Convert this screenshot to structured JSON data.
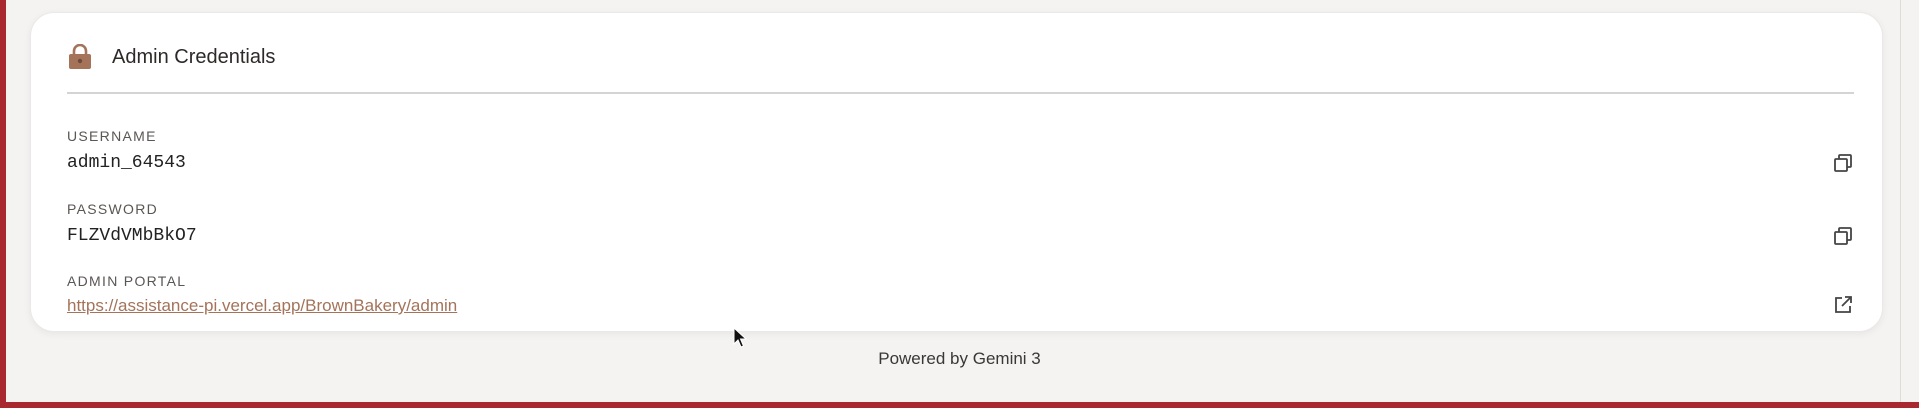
{
  "card": {
    "title": "Admin Credentials",
    "icon": "lock-icon",
    "accent_color": "#a4735a"
  },
  "fields": {
    "username": {
      "label": "USERNAME",
      "value": "admin_64543",
      "action_icon": "copy-icon"
    },
    "password": {
      "label": "PASSWORD",
      "value": "FLZVdVMbBkO7",
      "action_icon": "copy-icon"
    },
    "portal": {
      "label": "ADMIN PORTAL",
      "url": "https://assistance-pi.vercel.app/BrownBakery/admin",
      "action_icon": "external-link-icon"
    }
  },
  "footer": {
    "text": "Powered by Gemini 3"
  }
}
